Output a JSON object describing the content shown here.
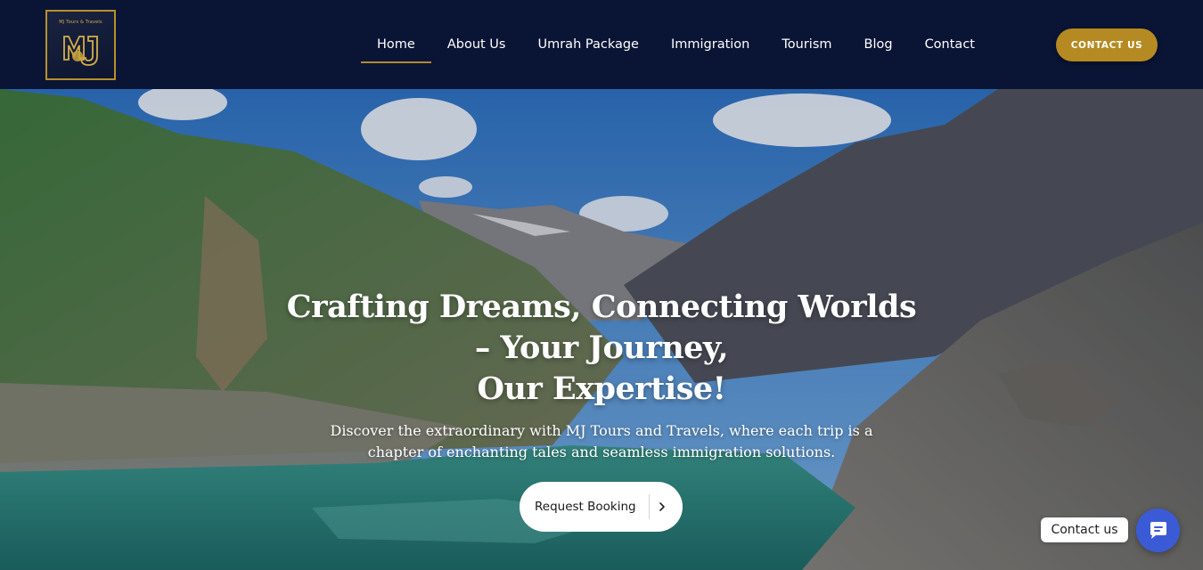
{
  "header": {
    "logo_text": "MJ Tours & Travels",
    "nav": [
      {
        "label": "Home",
        "active": true
      },
      {
        "label": "About Us"
      },
      {
        "label": "Umrah Package"
      },
      {
        "label": "Immigration"
      },
      {
        "label": "Tourism"
      },
      {
        "label": "Blog"
      },
      {
        "label": "Contact"
      }
    ],
    "cta_label": "CONTACT US"
  },
  "hero": {
    "title_lines": [
      "Crafting Dreams, Connecting Worlds",
      "– Your Journey,",
      "Our Expertise!"
    ],
    "subtitle_lines": [
      "Discover the extraordinary with MJ Tours and Travels, where each trip is a",
      "chapter of enchanting tales and seamless immigration solutions."
    ],
    "booking_label": "Request Booking",
    "booking_icon": "chevron-right-icon"
  },
  "chat": {
    "label": "Contact us",
    "icon": "chat-bubble-icon"
  },
  "colors": {
    "header_bg": "#0a1535",
    "accent_gold": "#b58a22",
    "chat_blue": "#3b5bd6"
  }
}
